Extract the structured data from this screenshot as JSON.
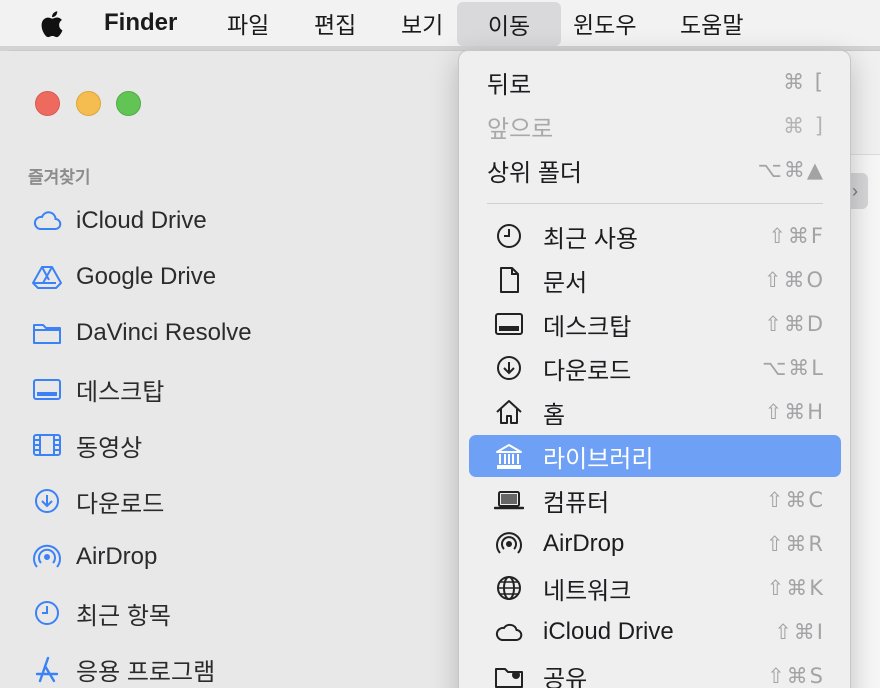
{
  "menubar": {
    "app_name": "Finder",
    "menus": [
      "파일",
      "편집",
      "보기",
      "이동",
      "윈도우",
      "도움말"
    ],
    "active_menu": "이동"
  },
  "sidebar": {
    "section_title": "즐겨찾기",
    "items": [
      {
        "label": "iCloud Drive",
        "icon": "cloud-icon"
      },
      {
        "label": "Google Drive",
        "icon": "google-drive-icon"
      },
      {
        "label": "DaVinci Resolve",
        "icon": "folder-icon"
      },
      {
        "label": "데스크탑",
        "icon": "desktop-icon"
      },
      {
        "label": "동영상",
        "icon": "film-icon"
      },
      {
        "label": "다운로드",
        "icon": "download-icon"
      },
      {
        "label": "AirDrop",
        "icon": "airdrop-icon"
      },
      {
        "label": "최근 항목",
        "icon": "clock-icon"
      },
      {
        "label": "응용 프로그램",
        "icon": "applications-icon"
      }
    ]
  },
  "go_menu": {
    "items": [
      {
        "label": "뒤로",
        "shortcut": "⌘ [",
        "enabled": true
      },
      {
        "label": "앞으로",
        "shortcut": "⌘ ]",
        "enabled": false
      },
      {
        "label": "상위 폴더",
        "shortcut": "⌥⌘▲",
        "enabled": true
      },
      {
        "label": "최근 사용",
        "shortcut": "⇧⌘F",
        "icon": "clock-icon"
      },
      {
        "label": "문서",
        "shortcut": "⇧⌘O",
        "icon": "document-icon"
      },
      {
        "label": "데스크탑",
        "shortcut": "⇧⌘D",
        "icon": "desktop-icon"
      },
      {
        "label": "다운로드",
        "shortcut": "⌥⌘L",
        "icon": "download-icon"
      },
      {
        "label": "홈",
        "shortcut": "⇧⌘H",
        "icon": "home-icon"
      },
      {
        "label": "라이브러리",
        "shortcut": "",
        "icon": "library-icon",
        "highlighted": true
      },
      {
        "label": "컴퓨터",
        "shortcut": "⇧⌘C",
        "icon": "laptop-icon"
      },
      {
        "label": "AirDrop",
        "shortcut": "⇧⌘R",
        "icon": "airdrop-icon"
      },
      {
        "label": "네트워크",
        "shortcut": "⇧⌘K",
        "icon": "network-icon"
      },
      {
        "label": "iCloud Drive",
        "shortcut": "⇧⌘I",
        "icon": "cloud-icon"
      },
      {
        "label": "공유",
        "shortcut": "⇧⌘S",
        "icon": "shared-folder-icon"
      }
    ]
  },
  "colors": {
    "accent": "#6ea0f5",
    "sidebar_icon": "#3b82f6"
  }
}
